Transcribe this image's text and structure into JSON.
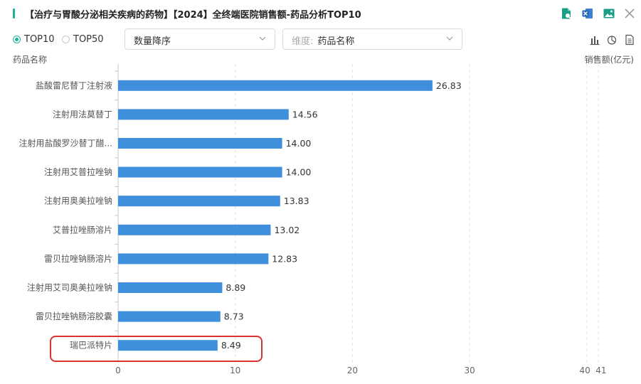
{
  "header": {
    "title": "【治疗与胃酸分泌相关疾病的药物】【2024】全终端医院销售额-药品分析TOP10"
  },
  "toolbar_icons": [
    "export-excel-icon",
    "excel-icon",
    "image-icon",
    "close-icon"
  ],
  "controls": {
    "radios": [
      {
        "label": "TOP10",
        "selected": true
      },
      {
        "label": "TOP50",
        "selected": false
      }
    ],
    "sort_select": {
      "value": "数量降序"
    },
    "dimension_select": {
      "label": "维度:",
      "value": "药品名称"
    },
    "view_icons": [
      "bar-chart-icon",
      "pie-chart-icon",
      "document-icon"
    ]
  },
  "colors": {
    "accent": "#1db59a",
    "bar": "#3f8fdc",
    "highlight": "#d9322c"
  },
  "chart_data": {
    "type": "bar",
    "orientation": "horizontal",
    "ylabel": "药品名称",
    "xlabel": "销售额(亿元)",
    "categories": [
      "盐酸雷尼替丁注射液",
      "注射用法莫替丁",
      "注射用盐酸罗沙替丁醋...",
      "注射用艾普拉唑钠",
      "注射用奥美拉唑钠",
      "艾普拉唑肠溶片",
      "雷贝拉唑钠肠溶片",
      "注射用艾司奥美拉唑钠",
      "雷贝拉唑钠肠溶胶囊",
      "瑞巴派特片"
    ],
    "values": [
      26.83,
      14.56,
      14.0,
      14.0,
      13.83,
      13.02,
      12.83,
      8.89,
      8.73,
      8.49
    ],
    "value_labels": [
      "26.83",
      "14.56",
      "14.00",
      "14.00",
      "13.83",
      "13.02",
      "12.83",
      "8.89",
      "8.73",
      "8.49"
    ],
    "xticks": [
      "0",
      "10",
      "20",
      "30",
      "40",
      "41"
    ],
    "xtick_values": [
      0,
      10,
      20,
      30,
      40,
      41
    ],
    "xlim": [
      0,
      41
    ],
    "grid": true,
    "highlighted_category": "瑞巴派特片"
  }
}
